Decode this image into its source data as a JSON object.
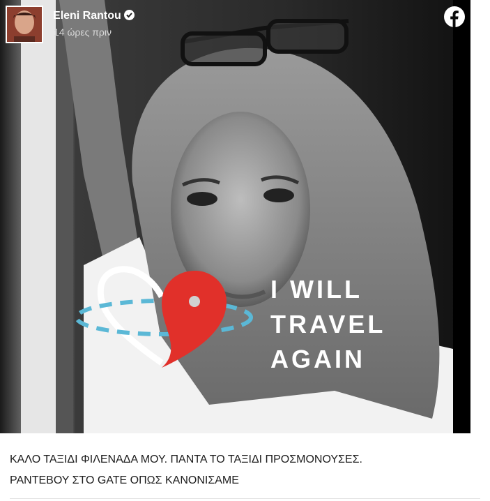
{
  "post": {
    "author": "Eleni Rantou",
    "timestamp": "14 ώρες πριν",
    "platform_icon": "facebook-icon",
    "verified_icon": "verified-badge-icon",
    "overlay": {
      "line1": "I WILL",
      "line2": "TRAVEL",
      "line3": "AGAIN"
    },
    "caption": {
      "line1": "ΚΑΛΟ ΤΑΞΙΔΙ ΦΙΛΕΝΑΔΑ ΜΟΥ. ΠΑΝΤΑ ΤΟ ΤΑΞΙΔΙ ΠΡΟΣΜΟΝΟΥΣΕΣ.",
      "line2": "ΡΑΝΤΕΒΟΥ ΣΤΟ GATE ΟΠΩΣ ΚΑΝΟΝΙΣΑΜΕ"
    }
  },
  "colors": {
    "pin_red": "#e1302a",
    "orbit_blue": "#5bb8d6",
    "overlay_text": "#ffffff"
  }
}
